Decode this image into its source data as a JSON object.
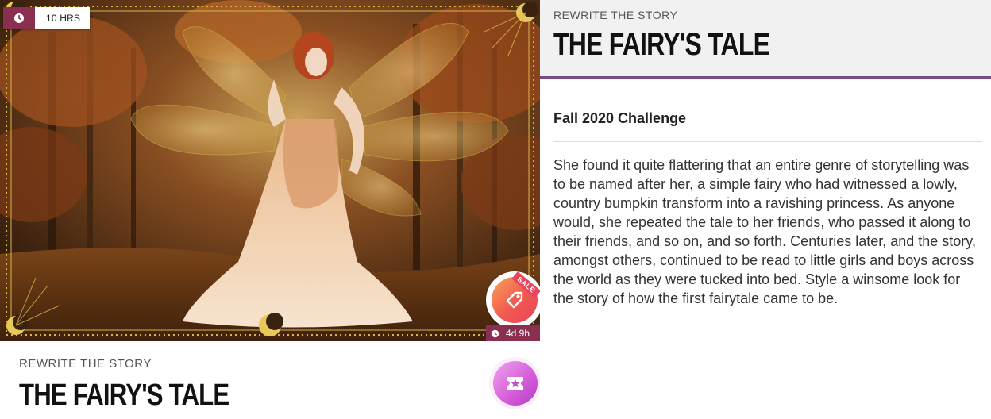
{
  "left": {
    "timer_label": "10 HRS",
    "sale_ribbon": "SALE",
    "sale_timer": "4d 9h",
    "kicker": "REWRITE THE STORY",
    "title": "THE FAIRY'S TALE"
  },
  "right": {
    "kicker": "REWRITE THE STORY",
    "title": "THE FAIRY'S TALE",
    "challenge": "Fall 2020 Challenge",
    "description": "She found it quite flattering that an entire genre of storytelling was to be named after her, a simple fairy who had witnessed a lowly, country bumpkin transform into a ravishing princess. As anyone would, she repeated the tale to her friends, who passed it along to their friends, and so on, and so forth. Centuries later, and the story, amongst others, continued to be read to little girls and boys across the world as they were tucked into bed. Style a winsome look for the story of how the first fairytale came to be."
  },
  "colors": {
    "accent_plum": "#8a2f4f",
    "header_rule": "#7b4a8a",
    "sale_gradient": [
      "#f9a35b",
      "#e8455d"
    ],
    "fab_gradient": [
      "#f0a4f0",
      "#b23fc4"
    ],
    "frame_gold": "#d9b64a"
  },
  "icons": {
    "timer": "clock-icon",
    "sale": "price-tag-icon",
    "fab": "star-ticket-icon"
  }
}
